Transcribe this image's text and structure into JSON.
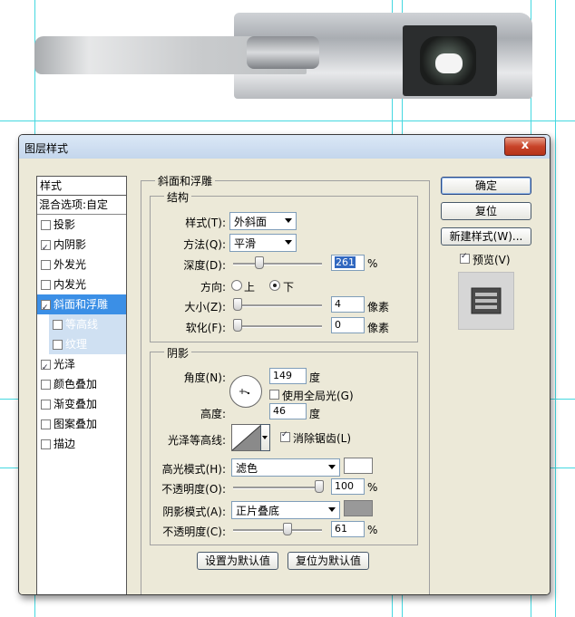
{
  "dialog": {
    "title": "图层样式",
    "close_label": "x"
  },
  "styles_panel": {
    "header": "样式",
    "blend_options": "混合选项:自定",
    "items": [
      {
        "label": "投影",
        "checked": false
      },
      {
        "label": "内阴影",
        "checked": true
      },
      {
        "label": "外发光",
        "checked": false
      },
      {
        "label": "内发光",
        "checked": false
      },
      {
        "label": "斜面和浮雕",
        "checked": true,
        "selected": true
      },
      {
        "label": "等高线",
        "checked": false,
        "sub": true
      },
      {
        "label": "纹理",
        "checked": false,
        "sub": true
      },
      {
        "label": "光泽",
        "checked": true
      },
      {
        "label": "颜色叠加",
        "checked": false
      },
      {
        "label": "渐变叠加",
        "checked": false
      },
      {
        "label": "图案叠加",
        "checked": false
      },
      {
        "label": "描边",
        "checked": false
      }
    ]
  },
  "bevel": {
    "group_title": "斜面和浮雕",
    "structure_title": "结构",
    "style_label": "样式(T):",
    "style_value": "外斜面",
    "technique_label": "方法(Q):",
    "technique_value": "平滑",
    "depth_label": "深度(D):",
    "depth_value": "261",
    "depth_unit": "%",
    "direction_label": "方向:",
    "dir_up": "上",
    "dir_down": "下",
    "direction_selected": "下",
    "size_label": "大小(Z):",
    "size_value": "4",
    "size_unit": "像素",
    "soften_label": "软化(F):",
    "soften_value": "0",
    "soften_unit": "像素"
  },
  "shading": {
    "title": "阴影",
    "angle_label": "角度(N):",
    "angle_value": "149",
    "angle_unit": "度",
    "global_light_label": "使用全局光(G)",
    "global_light_checked": false,
    "altitude_label": "高度:",
    "altitude_value": "46",
    "altitude_unit": "度",
    "gloss_contour_label": "光泽等高线:",
    "antialiased_label": "消除锯齿(L)",
    "antialiased_checked": true,
    "highlight_mode_label": "高光模式(H):",
    "highlight_mode_value": "滤色",
    "highlight_color": "#ffffff",
    "highlight_opacity_label": "不透明度(O):",
    "highlight_opacity_value": "100",
    "highlight_opacity_unit": "%",
    "shadow_mode_label": "阴影模式(A):",
    "shadow_mode_value": "正片叠底",
    "shadow_color": "#999999",
    "shadow_opacity_label": "不透明度(C):",
    "shadow_opacity_value": "61",
    "shadow_opacity_unit": "%"
  },
  "buttons": {
    "make_default": "设置为默认值",
    "reset_default": "复位为默认值",
    "ok": "确定",
    "reset": "复位",
    "new_style": "新建样式(W)...",
    "preview_label": "预览(V)",
    "preview_checked": true
  },
  "sliders": {
    "depth_pos": 0.27,
    "size_pos": 0.0,
    "soften_pos": 0.0,
    "highlight_opacity_pos": 1.0,
    "shadow_opacity_pos": 0.61
  }
}
